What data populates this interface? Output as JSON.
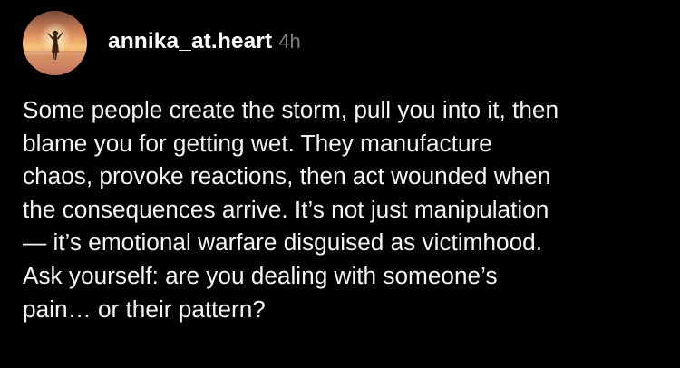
{
  "post": {
    "username": "annika_at.heart",
    "timestamp": "4h",
    "lines": [
      "Some people create the storm, pull you into it, then",
      "blame you for getting wet. They manufacture",
      "chaos, provoke reactions, then act wounded when",
      "the consequences arrive. It’s not just manipulation",
      "— it’s emotional warfare disguised as victimhood.",
      "Ask yourself: are you dealing with someone’s",
      "pain… or their pattern?"
    ]
  },
  "colors": {
    "background": "#000000",
    "username": "#ffffff",
    "timestamp": "#7d7d7d",
    "body_text": "#f5f5f5"
  },
  "icons": {
    "avatar": "profile-photo-sunset-silhouette"
  }
}
